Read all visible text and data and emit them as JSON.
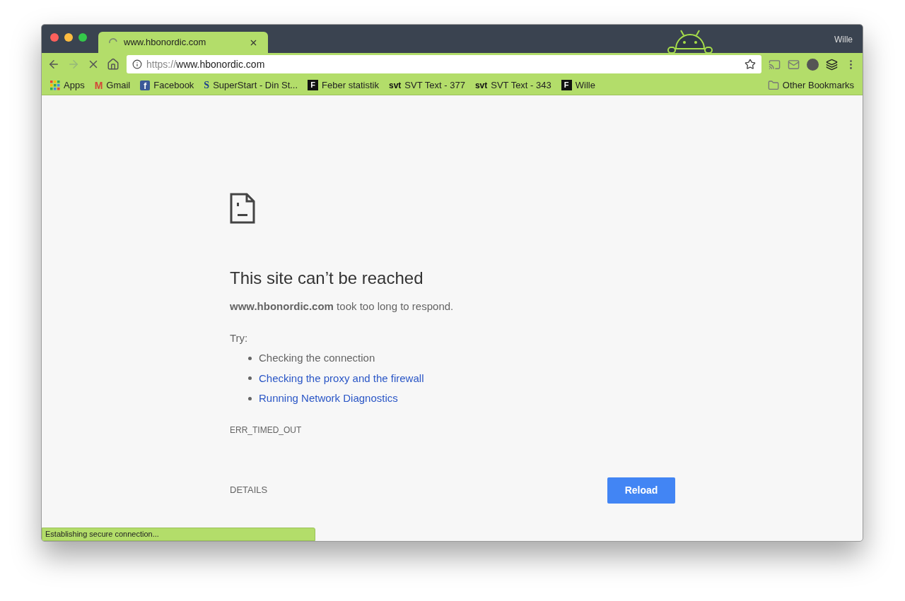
{
  "window": {
    "profile_name": "Wille"
  },
  "tabs": [
    {
      "title": "www.hbonordic.com",
      "selected": true,
      "loading": true
    }
  ],
  "address_bar": {
    "scheme": "https://",
    "host": "www.hbonordic.com"
  },
  "bookmarks": [
    {
      "label": "Apps",
      "kind": "grid"
    },
    {
      "label": "Gmail",
      "kind": "mail",
      "badge": "M"
    },
    {
      "label": "Facebook",
      "kind": "square",
      "badge": "f"
    },
    {
      "label": "SuperStart - Din St...",
      "kind": "letter",
      "badge": "S"
    },
    {
      "label": "Feber statistik",
      "kind": "dark",
      "badge": "F"
    },
    {
      "label": "SVT Text - 377",
      "kind": "word",
      "badge": "svt"
    },
    {
      "label": "SVT Text - 343",
      "kind": "word",
      "badge": "svt"
    },
    {
      "label": "Wille",
      "kind": "dark",
      "badge": "F"
    }
  ],
  "other_bookmarks": "Other Bookmarks",
  "error": {
    "heading": "This site can’t be reached",
    "message": "**www.hbonordic.com** took too long to respond.",
    "try_label": "Try:",
    "suggestions": [
      {
        "text": "Checking the connection",
        "kind": "text"
      },
      {
        "text": "Checking the proxy and the firewall",
        "kind": "link"
      },
      {
        "text": "Running Network Diagnostics",
        "kind": "link"
      }
    ],
    "code": "ERR_TIMED_OUT",
    "details_button": "DETAILS",
    "reload_button": "Reload"
  },
  "status_bar": "Establishing secure connection..."
}
